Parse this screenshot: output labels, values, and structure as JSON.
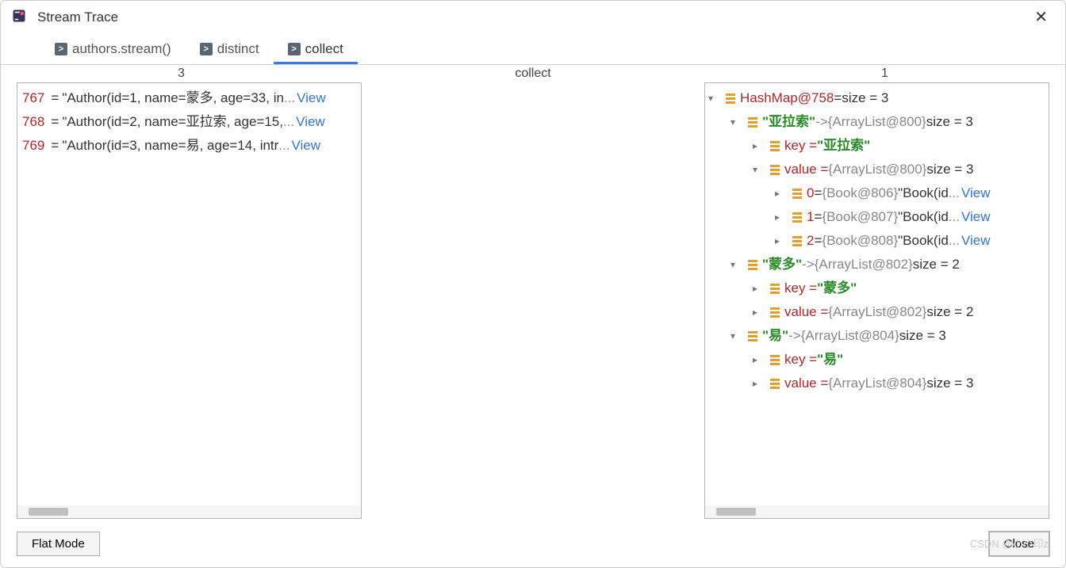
{
  "window": {
    "title": "Stream Trace"
  },
  "tabs": [
    {
      "label": "authors.stream()"
    },
    {
      "label": "distinct"
    },
    {
      "label": "collect"
    }
  ],
  "active_tab": 2,
  "stage": {
    "left_count": "3",
    "center_label": "collect",
    "right_count": "1"
  },
  "left_items": [
    {
      "id": "767",
      "text": "\"Author(id=1, name=蒙多, age=33, in",
      "view": "View"
    },
    {
      "id": "768",
      "text": "\"Author(id=2, name=亚拉索, age=15,",
      "view": "View"
    },
    {
      "id": "769",
      "text": "\"Author(id=3, name=易, age=14, intr",
      "view": "View"
    }
  ],
  "tree": {
    "root": {
      "name": "HashMap@758",
      "eq": " = ",
      "size": "size = 3"
    },
    "entries": [
      {
        "key_display": "\"亚拉索\"",
        "arrow": " -> ",
        "val_ref": "{ArrayList@800} ",
        "val_size": "size = 3",
        "key_row": {
          "label": "key = ",
          "value": "\"亚拉索\""
        },
        "value_row": {
          "label": "value = ",
          "ref": "{ArrayList@800} ",
          "size": "size = 3"
        },
        "value_expanded": true,
        "books": [
          {
            "idx": "0",
            "eq": " = ",
            "ref": "{Book@806} ",
            "text": "\"Book(id",
            "view": "View"
          },
          {
            "idx": "1",
            "eq": " = ",
            "ref": "{Book@807} ",
            "text": "\"Book(id",
            "view": "View"
          },
          {
            "idx": "2",
            "eq": " = ",
            "ref": "{Book@808} ",
            "text": "\"Book(id",
            "view": "View"
          }
        ]
      },
      {
        "key_display": "\"蒙多\"",
        "arrow": " -> ",
        "val_ref": "{ArrayList@802} ",
        "val_size": "size = 2",
        "key_row": {
          "label": "key = ",
          "value": "\"蒙多\""
        },
        "value_row": {
          "label": "value = ",
          "ref": "{ArrayList@802} ",
          "size": "size = 2"
        },
        "value_expanded": false
      },
      {
        "key_display": "\"易\"",
        "arrow": " -> ",
        "val_ref": "{ArrayList@804} ",
        "val_size": "size = 3",
        "key_row": {
          "label": "key = ",
          "value": "\"易\""
        },
        "value_row": {
          "label": "value = ",
          "ref": "{ArrayList@804} ",
          "size": "size = 3"
        },
        "value_expanded": false
      }
    ]
  },
  "buttons": {
    "flat_mode": "Flat Mode",
    "close": "Close"
  },
  "watermark": "CSDN @小小印z"
}
